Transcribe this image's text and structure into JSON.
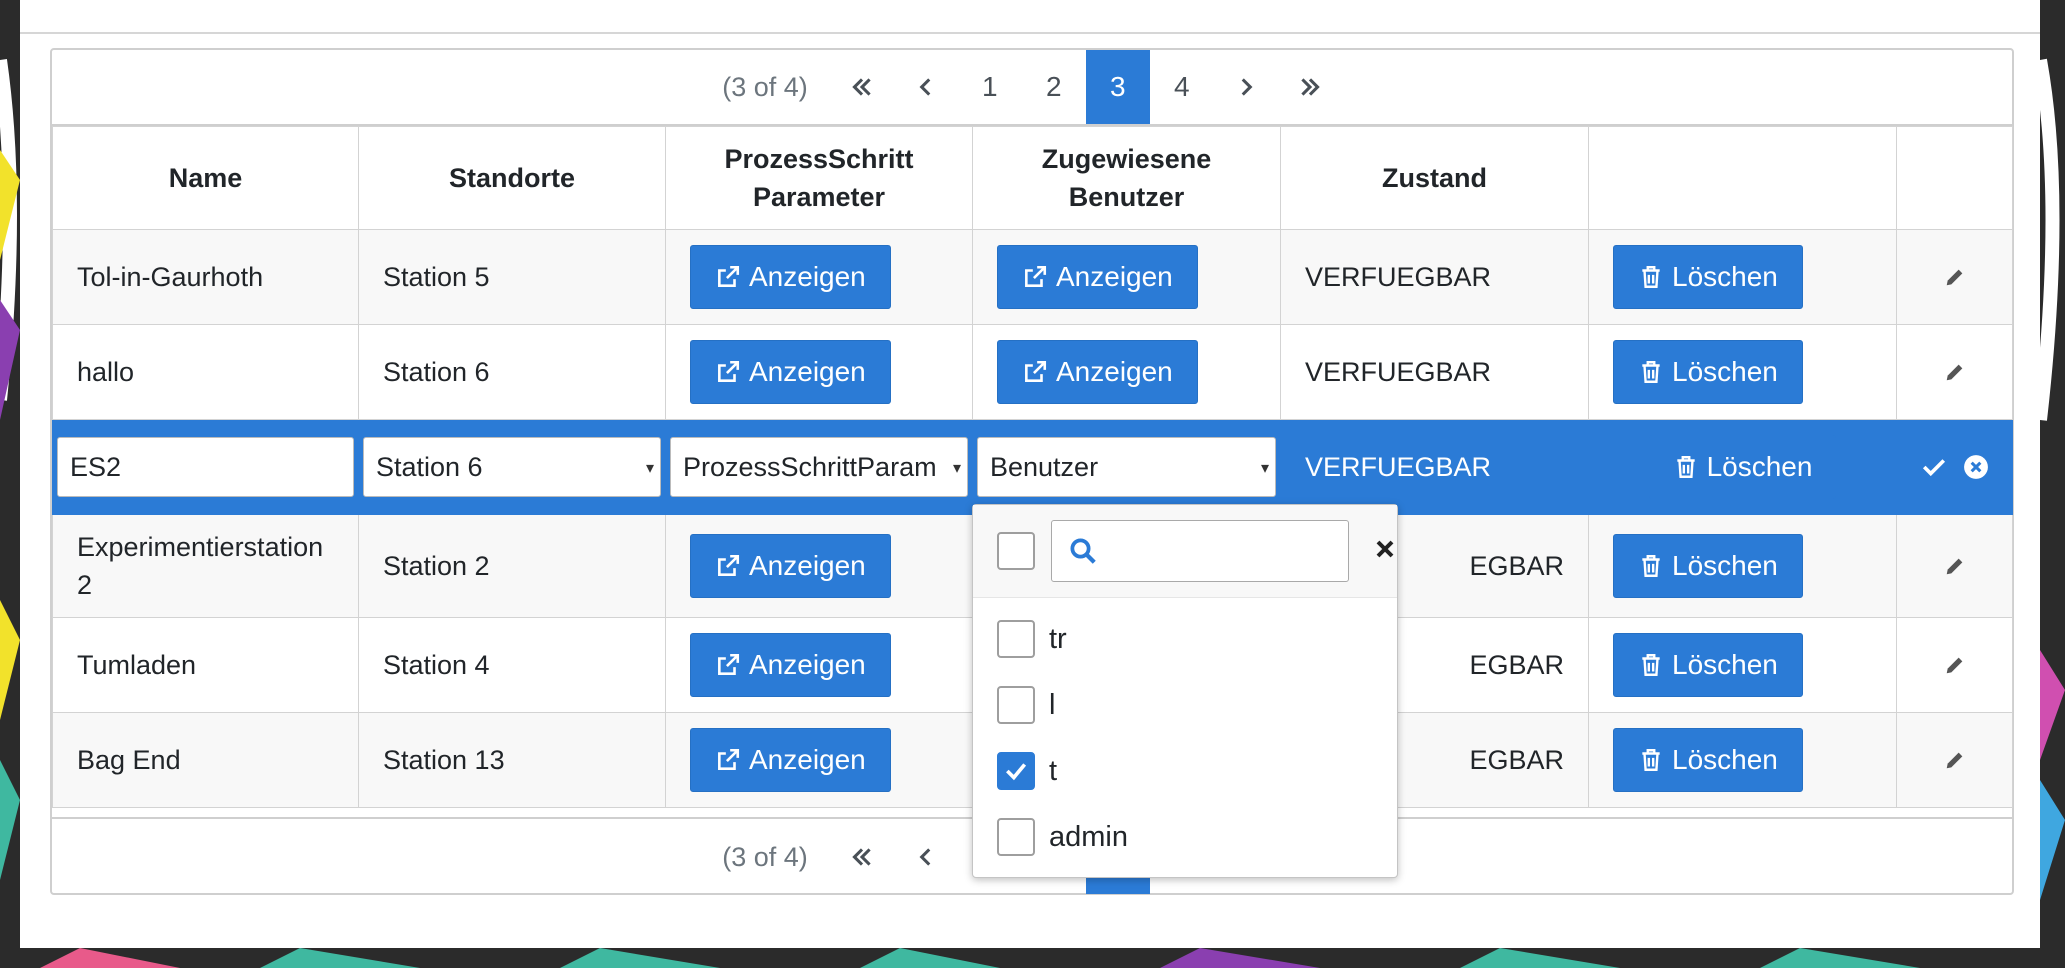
{
  "paginator": {
    "report": "(3 of 4)",
    "pages": [
      "1",
      "2",
      "3",
      "4"
    ],
    "active_page": "3"
  },
  "table": {
    "headers": {
      "name": "Name",
      "standorte": "Standorte",
      "prozess_line1": "ProzessSchritt",
      "prozess_line2": "Parameter",
      "benutzer_line1": "Zugewiesene",
      "benutzer_line2": "Benutzer",
      "zustand": "Zustand"
    },
    "rows": [
      {
        "name": "Tol-in-Gaurhoth",
        "standort": "Station 5",
        "zustand": "VERFUEGBAR"
      },
      {
        "name": "hallo",
        "standort": "Station 6",
        "zustand": "VERFUEGBAR"
      },
      {
        "name": "ES2",
        "standort": "Station 6",
        "prozess": "ProzessSchrittParam",
        "benutzer": "Benutzer",
        "zustand": "VERFUEGBAR"
      },
      {
        "name": "Experimentierstation",
        "name_line2": "2",
        "standort": "Station 2",
        "zustand": "EGBAR"
      },
      {
        "name": "Tumladen",
        "standort": "Station 4",
        "zustand": "EGBAR"
      },
      {
        "name": "Bag End",
        "standort": "Station 13",
        "zustand": "EGBAR"
      }
    ],
    "show_label": "Anzeigen",
    "delete_label": "Löschen"
  },
  "dropdown": {
    "options": [
      {
        "label": "tr",
        "checked": false
      },
      {
        "label": "l",
        "checked": false
      },
      {
        "label": "t",
        "checked": true
      },
      {
        "label": "admin",
        "checked": false
      }
    ]
  },
  "colors": {
    "primary": "#2b7bd6",
    "border": "#d3d3d3"
  }
}
